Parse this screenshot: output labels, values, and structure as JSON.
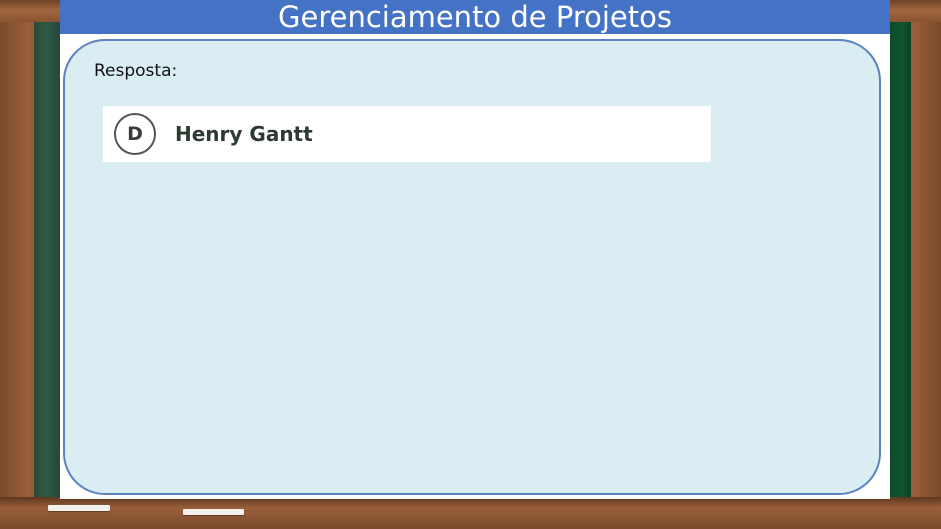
{
  "slide": {
    "title": "Gerenciamento de Projetos"
  },
  "answer": {
    "label": "Resposta:",
    "option": {
      "letter": "D",
      "text": "Henry Gantt"
    }
  },
  "colors": {
    "title_bar": "#4472c4",
    "panel_fill": "#daedf3",
    "panel_border": "#5b84bf",
    "frame_wood": "#9a603b",
    "chalkboard_green": "#0f5530"
  }
}
